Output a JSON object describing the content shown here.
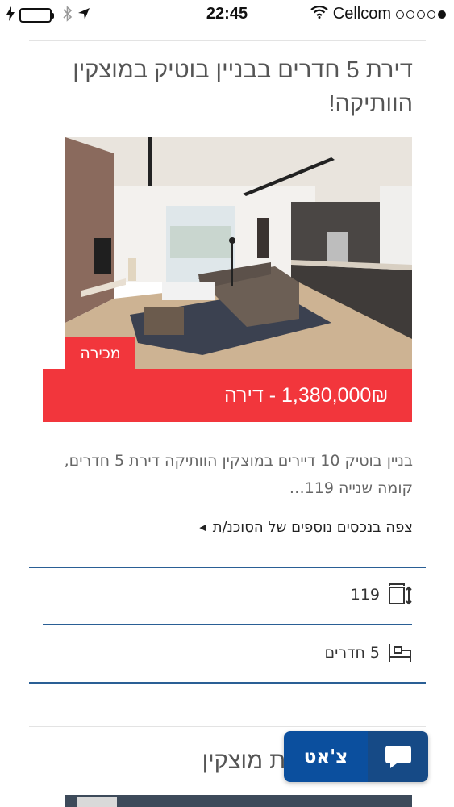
{
  "status_bar": {
    "time": "22:45",
    "carrier": "Cellcom",
    "battery_color": "#4cd964"
  },
  "listing": {
    "title": "דירת 5 חדרים בבניין בוטיק במוצקין הוותיקה!",
    "badge": "מכירה",
    "price_text": "1,380,000₪ - דירה",
    "description": "בניין בוטיק 10 דיירים במוצקין הוותיקה דירת 5 חדרים, קומה שנייה 119…",
    "more_link": "צפה בנכסים נוספים של הסוכנ/ת",
    "area": "119",
    "rooms": "5 חדרים",
    "accent_color": "#f2363c",
    "divider_color": "#2a5f95"
  },
  "listing2": {
    "title_partial": "'ס אחד בקריית מוצקין"
  },
  "chat": {
    "label": "צ'אט",
    "color": "#0b4f9e"
  }
}
